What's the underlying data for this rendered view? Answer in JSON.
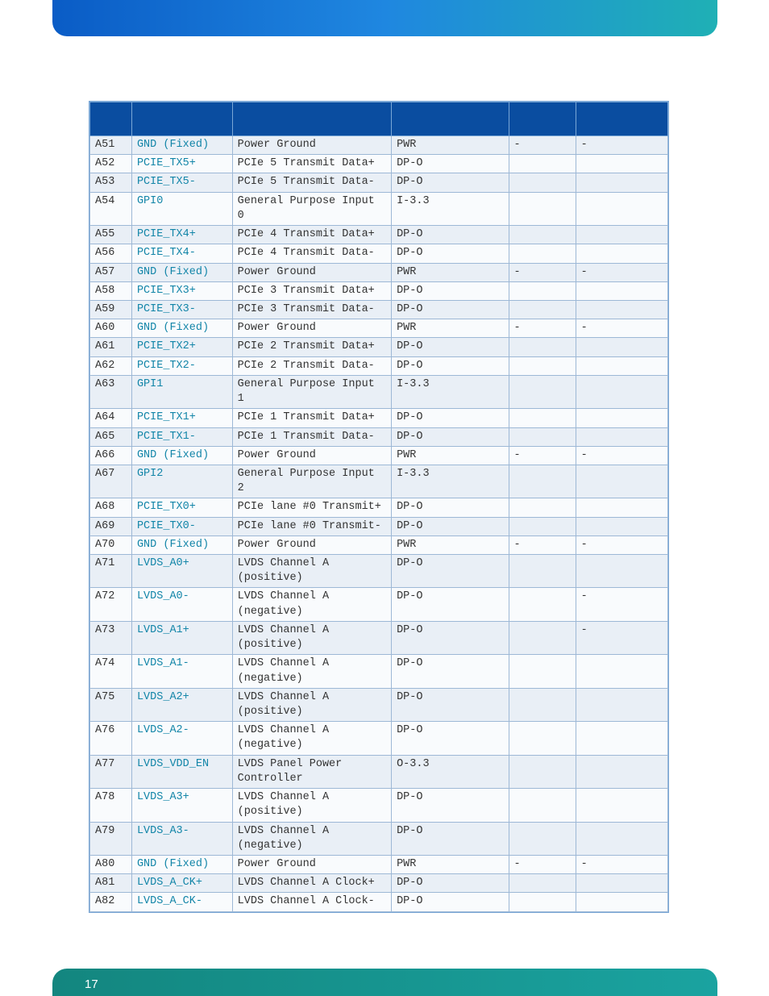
{
  "page_number": "17",
  "headers": {
    "pin": "",
    "signal": "",
    "desc": "",
    "type": "",
    "pu": "",
    "cmt": ""
  },
  "rows": [
    {
      "pin": "A51",
      "signal": "GND (Fixed)",
      "desc": "Power Ground",
      "type": "PWR",
      "pu": "-",
      "cmt": "-"
    },
    {
      "pin": "A52",
      "signal": "PCIE_TX5+",
      "desc": "PCIe 5 Transmit Data+",
      "type": "DP-O",
      "pu": "",
      "cmt": ""
    },
    {
      "pin": "A53",
      "signal": "PCIE_TX5-",
      "desc": "PCIe 5 Transmit Data-",
      "type": "DP-O",
      "pu": "",
      "cmt": ""
    },
    {
      "pin": "A54",
      "signal": "GPI0",
      "desc": "General Purpose Input 0",
      "type": "I-3.3",
      "pu": "",
      "cmt": ""
    },
    {
      "pin": "A55",
      "signal": "PCIE_TX4+",
      "desc": "PCIe 4 Transmit Data+",
      "type": "DP-O",
      "pu": "",
      "cmt": ""
    },
    {
      "pin": "A56",
      "signal": "PCIE_TX4-",
      "desc": "PCIe 4 Transmit Data-",
      "type": "DP-O",
      "pu": "",
      "cmt": ""
    },
    {
      "pin": "A57",
      "signal": "GND (Fixed)",
      "desc": "Power Ground",
      "type": "PWR",
      "pu": "-",
      "cmt": "-"
    },
    {
      "pin": "A58",
      "signal": "PCIE_TX3+",
      "desc": "PCIe 3 Transmit Data+",
      "type": "DP-O",
      "pu": "",
      "cmt": ""
    },
    {
      "pin": "A59",
      "signal": "PCIE_TX3-",
      "desc": "PCIe 3 Transmit Data-",
      "type": "DP-O",
      "pu": "",
      "cmt": ""
    },
    {
      "pin": "A60",
      "signal": "GND (Fixed)",
      "desc": "Power Ground",
      "type": "PWR",
      "pu": "-",
      "cmt": "-"
    },
    {
      "pin": "A61",
      "signal": "PCIE_TX2+",
      "desc": "PCIe 2 Transmit Data+",
      "type": "DP-O",
      "pu": "",
      "cmt": ""
    },
    {
      "pin": "A62",
      "signal": "PCIE_TX2-",
      "desc": "PCIe 2 Transmit Data-",
      "type": "DP-O",
      "pu": "",
      "cmt": ""
    },
    {
      "pin": "A63",
      "signal": "GPI1",
      "desc": "General Purpose Input 1",
      "type": "I-3.3",
      "pu": "",
      "cmt": ""
    },
    {
      "pin": "A64",
      "signal": "PCIE_TX1+",
      "desc": "PCIe 1 Transmit Data+",
      "type": "DP-O",
      "pu": "",
      "cmt": ""
    },
    {
      "pin": "A65",
      "signal": "PCIE_TX1-",
      "desc": "PCIe 1 Transmit Data-",
      "type": "DP-O",
      "pu": "",
      "cmt": ""
    },
    {
      "pin": "A66",
      "signal": "GND (Fixed)",
      "desc": "Power Ground",
      "type": "PWR",
      "pu": "-",
      "cmt": "-"
    },
    {
      "pin": "A67",
      "signal": "GPI2",
      "desc": "General Purpose Input 2",
      "type": "I-3.3",
      "pu": "",
      "cmt": ""
    },
    {
      "pin": "A68",
      "signal": "PCIE_TX0+",
      "desc": "PCIe lane #0 Transmit+",
      "type": "DP-O",
      "pu": "",
      "cmt": ""
    },
    {
      "pin": "A69",
      "signal": "PCIE_TX0-",
      "desc": "PCIe lane #0 Transmit-",
      "type": "DP-O",
      "pu": "",
      "cmt": ""
    },
    {
      "pin": "A70",
      "signal": "GND (Fixed)",
      "desc": "Power Ground",
      "type": "PWR",
      "pu": "-",
      "cmt": "-"
    },
    {
      "pin": "A71",
      "signal": "LVDS_A0+",
      "desc": "LVDS Channel A (positive)",
      "type": "DP-O",
      "pu": "",
      "cmt": ""
    },
    {
      "pin": "A72",
      "signal": "LVDS_A0-",
      "desc": "LVDS Channel A (negative)",
      "type": "DP-O",
      "pu": "",
      "cmt": "-"
    },
    {
      "pin": "A73",
      "signal": "LVDS_A1+",
      "desc": "LVDS Channel A (positive)",
      "type": "DP-O",
      "pu": "",
      "cmt": "-"
    },
    {
      "pin": "A74",
      "signal": "LVDS_A1-",
      "desc": "LVDS Channel A (negative)",
      "type": "DP-O",
      "pu": "",
      "cmt": ""
    },
    {
      "pin": "A75",
      "signal": "LVDS_A2+",
      "desc": "LVDS Channel A (positive)",
      "type": "DP-O",
      "pu": "",
      "cmt": ""
    },
    {
      "pin": "A76",
      "signal": "LVDS_A2-",
      "desc": "LVDS Channel A (negative)",
      "type": "DP-O",
      "pu": "",
      "cmt": ""
    },
    {
      "pin": "A77",
      "signal": "LVDS_VDD_EN",
      "desc": "LVDS Panel Power Controller",
      "type": "O-3.3",
      "pu": "",
      "cmt": ""
    },
    {
      "pin": "A78",
      "signal": "LVDS_A3+",
      "desc": "LVDS Channel A (positive)",
      "type": "DP-O",
      "pu": "",
      "cmt": ""
    },
    {
      "pin": "A79",
      "signal": "LVDS_A3-",
      "desc": "LVDS Channel A (negative)",
      "type": "DP-O",
      "pu": "",
      "cmt": ""
    },
    {
      "pin": "A80",
      "signal": "GND (Fixed)",
      "desc": "Power Ground",
      "type": "PWR",
      "pu": "-",
      "cmt": "-"
    },
    {
      "pin": "A81",
      "signal": "LVDS_A_CK+",
      "desc": "LVDS Channel A Clock+",
      "type": "DP-O",
      "pu": "",
      "cmt": ""
    },
    {
      "pin": "A82",
      "signal": "LVDS_A_CK-",
      "desc": "LVDS Channel A Clock-",
      "type": "DP-O",
      "pu": "",
      "cmt": ""
    }
  ]
}
